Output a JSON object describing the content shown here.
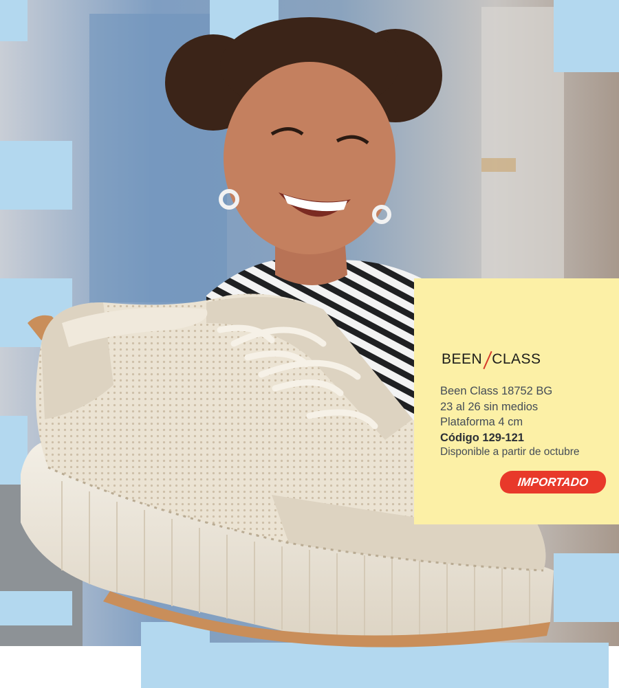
{
  "brand": {
    "logo_text_left": "BEEN",
    "logo_text_right": "CLASS"
  },
  "product": {
    "model": "Been Class 18752 BG",
    "sizes": "23 al 26 sin medios",
    "platform": "Plataforma 4 cm",
    "code": "Código 129-121",
    "availability": "Disponible a partir de octubre"
  },
  "badge": {
    "label": "IMPORTADO"
  },
  "colors": {
    "card_background": "#fcf0a6",
    "badge": "#e8392a",
    "tile_blue": "#b3d8ef",
    "shoe": "#e7dfd0"
  }
}
